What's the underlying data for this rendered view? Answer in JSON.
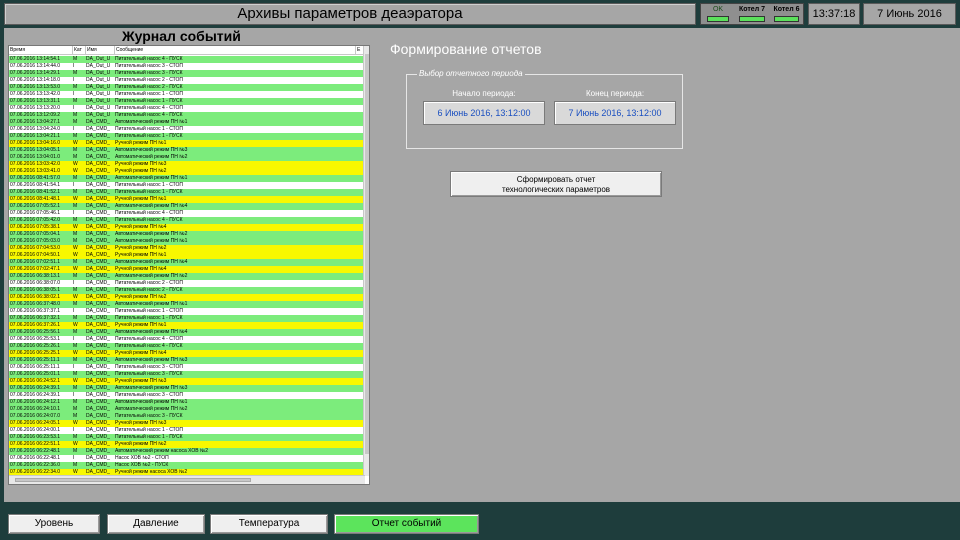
{
  "header": {
    "title": "Архивы параметров деаэратора",
    "status": [
      {
        "label": "OK",
        "lamp_color": "#5be05b"
      },
      {
        "label": "Котел 7",
        "lamp_color": "#5be05b"
      },
      {
        "label": "Котел 6",
        "lamp_color": "#5be05b"
      }
    ],
    "time": "13:37:18",
    "date": "7 Июнь 2016"
  },
  "journal": {
    "title": "Журнал событий",
    "columns": [
      "Время",
      "Кат",
      "Имя",
      "Сообщение"
    ],
    "rows": [
      {
        "time": "07.06.2016 13:14:54.1",
        "cat": "M",
        "name": "DA_Out_U",
        "msg": "Питательный насос 4 - ПУСК",
        "bg": "g"
      },
      {
        "time": "07.06.2016 13:14:44.0",
        "cat": "I",
        "name": "DA_Out_U",
        "msg": "Питательный насос 3 - СТОП",
        "bg": "w"
      },
      {
        "time": "07.06.2016 13:14:29.1",
        "cat": "M",
        "name": "DA_Out_U",
        "msg": "Питательный насос 3 - ПУСК",
        "bg": "g"
      },
      {
        "time": "07.06.2016 13:14:18.0",
        "cat": "I",
        "name": "DA_Out_U",
        "msg": "Питательный насос 2 - СТОП",
        "bg": "w"
      },
      {
        "time": "07.06.2016 13:13:53.0",
        "cat": "M",
        "name": "DA_Out_U",
        "msg": "Питательный насос 2 - ПУСК",
        "bg": "g"
      },
      {
        "time": "07.06.2016 13:13:42.0",
        "cat": "I",
        "name": "DA_Out_U",
        "msg": "Питательный насос 1 - СТОП",
        "bg": "w"
      },
      {
        "time": "07.06.2016 13:13:31.1",
        "cat": "M",
        "name": "DA_Out_U",
        "msg": "Питательный насос 1 - ПУСК",
        "bg": "g"
      },
      {
        "time": "07.06.2016 13:13:20.0",
        "cat": "I",
        "name": "DA_Out_U",
        "msg": "Питательный насос 4 - СТОП",
        "bg": "w"
      },
      {
        "time": "07.06.2016 13:12:09.2",
        "cat": "M",
        "name": "DA_Out_U",
        "msg": "Питательный насос 4 - ПУСК",
        "bg": "g"
      },
      {
        "time": "07.06.2016 13:04:27.1",
        "cat": "M",
        "name": "DA_CMD_",
        "msg": "Автоматический режим ПН №1",
        "bg": "g"
      },
      {
        "time": "07.06.2016 13:04:24.0",
        "cat": "I",
        "name": "DA_CMD_",
        "msg": "Питательный насос 1 - СТОП",
        "bg": "w"
      },
      {
        "time": "07.06.2016 13:04:21.1",
        "cat": "M",
        "name": "DA_CMD_",
        "msg": "Питательный насос 1 - ПУСК",
        "bg": "g"
      },
      {
        "time": "07.06.2016 13:04:16.0",
        "cat": "W",
        "name": "DA_CMD_",
        "msg": "Ручной режим ПН №1",
        "bg": "y"
      },
      {
        "time": "07.06.2016 13:04:05.1",
        "cat": "M",
        "name": "DA_CMD_",
        "msg": "Автоматический режим ПН №3",
        "bg": "g"
      },
      {
        "time": "07.06.2016 13:04:01.0",
        "cat": "M",
        "name": "DA_CMD_",
        "msg": "Автоматический режим ПН №2",
        "bg": "g"
      },
      {
        "time": "07.06.2016 13:03:42.0",
        "cat": "W",
        "name": "DA_CMD_",
        "msg": "Ручной режим ПН №3",
        "bg": "y"
      },
      {
        "time": "07.06.2016 13:03:41.0",
        "cat": "W",
        "name": "DA_CMD_",
        "msg": "Ручной режим ПН №2",
        "bg": "y"
      },
      {
        "time": "07.06.2016 08:41:57.0",
        "cat": "M",
        "name": "DA_CMD_",
        "msg": "Автоматический режим ПН №1",
        "bg": "g"
      },
      {
        "time": "07.06.2016 08:41:54.1",
        "cat": "I",
        "name": "DA_CMD_",
        "msg": "Питательный насос 1 - СТОП",
        "bg": "w"
      },
      {
        "time": "07.06.2016 08:41:52.1",
        "cat": "M",
        "name": "DA_CMD_",
        "msg": "Питательный насос 1 - ПУСК",
        "bg": "g"
      },
      {
        "time": "07.06.2016 08:41:48.1",
        "cat": "W",
        "name": "DA_CMD_",
        "msg": "Ручной режим ПН №1",
        "bg": "y"
      },
      {
        "time": "07.06.2016 07:05:52.1",
        "cat": "M",
        "name": "DA_CMD_",
        "msg": "Автоматический режим ПН №4",
        "bg": "g"
      },
      {
        "time": "07.06.2016 07:05:46.1",
        "cat": "I",
        "name": "DA_CMD_",
        "msg": "Питательный насос 4 - СТОП",
        "bg": "w"
      },
      {
        "time": "07.06.2016 07:05:42.0",
        "cat": "M",
        "name": "DA_CMD_",
        "msg": "Питательный насос 4 - ПУСК",
        "bg": "g"
      },
      {
        "time": "07.06.2016 07:05:38.1",
        "cat": "W",
        "name": "DA_CMD_",
        "msg": "Ручной режим ПН №4",
        "bg": "y"
      },
      {
        "time": "07.06.2016 07:05:04.1",
        "cat": "M",
        "name": "DA_CMD_",
        "msg": "Автоматический режим ПН №2",
        "bg": "g"
      },
      {
        "time": "07.06.2016 07:05:03.0",
        "cat": "M",
        "name": "DA_CMD_",
        "msg": "Автоматический режим ПН №1",
        "bg": "g"
      },
      {
        "time": "07.06.2016 07:04:53.0",
        "cat": "W",
        "name": "DA_CMD_",
        "msg": "Ручной режим ПН №2",
        "bg": "y"
      },
      {
        "time": "07.06.2016 07:04:50.1",
        "cat": "W",
        "name": "DA_CMD_",
        "msg": "Ручной режим ПН №1",
        "bg": "y"
      },
      {
        "time": "07.06.2016 07:02:51.1",
        "cat": "M",
        "name": "DA_CMD_",
        "msg": "Автоматический режим ПН №4",
        "bg": "g"
      },
      {
        "time": "07.06.2016 07:02:47.1",
        "cat": "W",
        "name": "DA_CMD_",
        "msg": "Ручной режим ПН №4",
        "bg": "y"
      },
      {
        "time": "07.06.2016 06:38:13.1",
        "cat": "M",
        "name": "DA_CMD_",
        "msg": "Автоматический режим ПН №2",
        "bg": "g"
      },
      {
        "time": "07.06.2016 06:38:07.0",
        "cat": "I",
        "name": "DA_CMD_",
        "msg": "Питательный насос 2 - СТОП",
        "bg": "w"
      },
      {
        "time": "07.06.2016 06:38:05.1",
        "cat": "M",
        "name": "DA_CMD_",
        "msg": "Питательный насос 2 - ПУСК",
        "bg": "g"
      },
      {
        "time": "07.06.2016 06:38:02.1",
        "cat": "W",
        "name": "DA_CMD_",
        "msg": "Ручной режим ПН №2",
        "bg": "y"
      },
      {
        "time": "07.06.2016 06:37:48.0",
        "cat": "M",
        "name": "DA_CMD_",
        "msg": "Автоматический режим ПН №1",
        "bg": "g"
      },
      {
        "time": "07.06.2016 06:37:37.1",
        "cat": "I",
        "name": "DA_CMD_",
        "msg": "Питательный насос 1 - СТОП",
        "bg": "w"
      },
      {
        "time": "07.06.2016 06:37:32.1",
        "cat": "M",
        "name": "DA_CMD_",
        "msg": "Питательный насос 1 - ПУСК",
        "bg": "g"
      },
      {
        "time": "07.06.2016 06:37:26.1",
        "cat": "W",
        "name": "DA_CMD_",
        "msg": "Ручной режим ПН №1",
        "bg": "y"
      },
      {
        "time": "07.06.2016 06:25:56.1",
        "cat": "M",
        "name": "DA_CMD_",
        "msg": "Автоматический режим ПН №4",
        "bg": "g"
      },
      {
        "time": "07.06.2016 06:25:53.1",
        "cat": "I",
        "name": "DA_CMD_",
        "msg": "Питательный насос 4 - СТОП",
        "bg": "w"
      },
      {
        "time": "07.06.2016 06:25:26.1",
        "cat": "M",
        "name": "DA_CMD_",
        "msg": "Питательный насос 4 - ПУСК",
        "bg": "g"
      },
      {
        "time": "07.06.2016 06:25:25.1",
        "cat": "W",
        "name": "DA_CMD_",
        "msg": "Ручной режим ПН №4",
        "bg": "y"
      },
      {
        "time": "07.06.2016 06:25:11.1",
        "cat": "M",
        "name": "DA_CMD_",
        "msg": "Автоматический режим ПН №3",
        "bg": "g"
      },
      {
        "time": "07.06.2016 06:25:11.1",
        "cat": "I",
        "name": "DA_CMD_",
        "msg": "Питательный насос 3 - СТОП",
        "bg": "w"
      },
      {
        "time": "07.06.2016 06:25:01.1",
        "cat": "M",
        "name": "DA_CMD_",
        "msg": "Питательный насос 3 - ПУСК",
        "bg": "g"
      },
      {
        "time": "07.06.2016 06:24:52.1",
        "cat": "W",
        "name": "DA_CMD_",
        "msg": "Ручной режим ПН №3",
        "bg": "y"
      },
      {
        "time": "07.06.2016 06:24:39.1",
        "cat": "M",
        "name": "DA_CMD_",
        "msg": "Автоматический режим ПН №3",
        "bg": "g"
      },
      {
        "time": "07.06.2016 06:24:39.1",
        "cat": "I",
        "name": "DA_CMD_",
        "msg": "Питательный насос 3 - СТОП",
        "bg": "w"
      },
      {
        "time": "07.06.2016 06:24:12.1",
        "cat": "M",
        "name": "DA_CMD_",
        "msg": "Автоматический режим ПН №1",
        "bg": "g"
      },
      {
        "time": "07.06.2016 06:24:10.1",
        "cat": "M",
        "name": "DA_CMD_",
        "msg": "Автоматический режим ПН №2",
        "bg": "g"
      },
      {
        "time": "07.06.2016 06:24:07.0",
        "cat": "M",
        "name": "DA_CMD_",
        "msg": "Питательный насос 3 - ПУСК",
        "bg": "g"
      },
      {
        "time": "07.06.2016 06:24:05.1",
        "cat": "W",
        "name": "DA_CMD_",
        "msg": "Ручной режим ПН №3",
        "bg": "y"
      },
      {
        "time": "07.06.2016 06:24:00.1",
        "cat": "I",
        "name": "DA_CMD_",
        "msg": "Питательный насос 1 - СТОП",
        "bg": "w"
      },
      {
        "time": "07.06.2016 06:23:53.1",
        "cat": "M",
        "name": "DA_CMD_",
        "msg": "Питательный насос 1 - ПУСК",
        "bg": "g"
      },
      {
        "time": "07.06.2016 06:22:51.1",
        "cat": "W",
        "name": "DA_CMD_",
        "msg": "Ручной режим ПН №2",
        "bg": "y"
      },
      {
        "time": "07.06.2016 06:22:48.1",
        "cat": "M",
        "name": "DA_CMD_",
        "msg": "Автоматический режим насоса ХОВ №2",
        "bg": "g"
      },
      {
        "time": "07.06.2016 06:22:48.1",
        "cat": "I",
        "name": "DA_CMD_",
        "msg": "Насос ХОВ №2 - СТОП",
        "bg": "w"
      },
      {
        "time": "07.06.2016 06:22:36.0",
        "cat": "M",
        "name": "DA_CMD_",
        "msg": "Насос ХОВ №2 - ПУСК",
        "bg": "g"
      },
      {
        "time": "07.06.2016 06:22:34.0",
        "cat": "W",
        "name": "DA_CMD_",
        "msg": "Ручной режим насоса ХОВ №2",
        "bg": "y"
      }
    ]
  },
  "reports": {
    "title": "Формирование отчетов",
    "period_legend": "Выбор отчетного периода",
    "start_label": "Начало периода:",
    "start_value": "6 Июнь 2016, 13:12:00",
    "end_label": "Конец периода:",
    "end_value": "7 Июнь 2016, 13:12:00",
    "generate_line1": "Сформировать отчет",
    "generate_line2": "технологических параметров"
  },
  "nav": {
    "level": "Уровень",
    "pressure": "Давление",
    "temperature": "Температура",
    "events": "Отчет событий",
    "active_color": "#5ce45c"
  }
}
